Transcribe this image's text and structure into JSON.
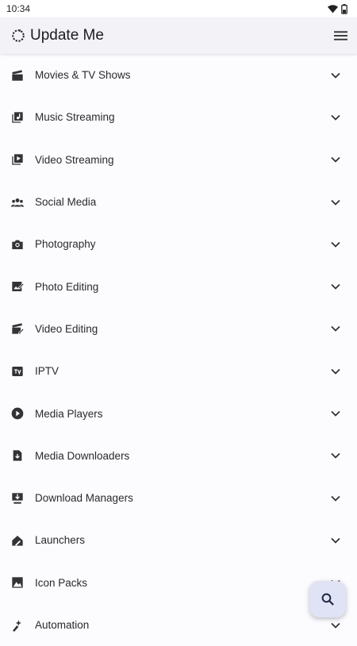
{
  "status": {
    "time": "10:34"
  },
  "app": {
    "title": "Update Me"
  },
  "categories": [
    {
      "label": "Movies & TV Shows",
      "icon": "clapperboard-icon"
    },
    {
      "label": "Music Streaming",
      "icon": "music-library-icon"
    },
    {
      "label": "Video Streaming",
      "icon": "video-library-icon"
    },
    {
      "label": "Social Media",
      "icon": "people-icon"
    },
    {
      "label": "Photography",
      "icon": "camera-icon"
    },
    {
      "label": "Photo Editing",
      "icon": "photo-edit-icon"
    },
    {
      "label": "Video Editing",
      "icon": "video-edit-icon"
    },
    {
      "label": "IPTV",
      "icon": "tv-icon"
    },
    {
      "label": "Media Players",
      "icon": "play-circle-icon"
    },
    {
      "label": "Media Downloaders",
      "icon": "file-download-icon"
    },
    {
      "label": "Download Managers",
      "icon": "download-to-screen-icon"
    },
    {
      "label": "Launchers",
      "icon": "launcher-icon"
    },
    {
      "label": "Icon Packs",
      "icon": "image-icon"
    },
    {
      "label": "Automation",
      "icon": "automation-icon"
    }
  ],
  "colors": {
    "accent_fab": "#dfe3f5",
    "appbar": "#f3f2f6",
    "background": "#fcfbfe"
  }
}
